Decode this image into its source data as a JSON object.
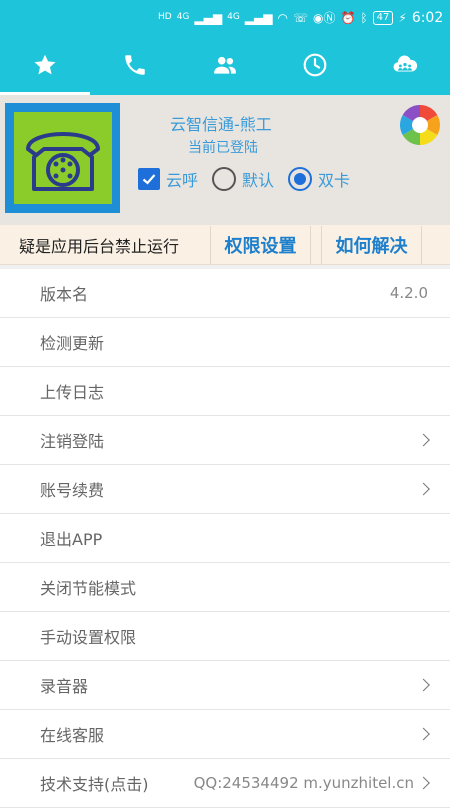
{
  "status_bar": {
    "left_indicators": [
      "HD",
      "HD",
      "4G",
      "4G"
    ],
    "battery": "47",
    "time": "6:02"
  },
  "tabs": [
    {
      "icon": "star-icon",
      "active": true
    },
    {
      "icon": "phone-icon",
      "active": false
    },
    {
      "icon": "contacts-icon",
      "active": false
    },
    {
      "icon": "clock-icon",
      "active": false
    },
    {
      "icon": "cloud-group-icon",
      "active": false
    }
  ],
  "profile": {
    "account_name": "云智信通-熊工",
    "login_status": "当前已登陆",
    "options": {
      "cloud_call": {
        "label": "云呼",
        "checked": true
      },
      "default": {
        "label": "默认",
        "selected": false
      },
      "dual_sim": {
        "label": "双卡",
        "selected": true
      }
    }
  },
  "warning": {
    "text": "疑是应用后台禁止运行",
    "permission_button": "权限设置",
    "howto_button": "如何解决"
  },
  "settings": [
    {
      "label": "版本名",
      "value": "4.2.0",
      "chevron": false
    },
    {
      "label": "检测更新",
      "value": "",
      "chevron": false
    },
    {
      "label": "上传日志",
      "value": "",
      "chevron": false
    },
    {
      "label": "注销登陆",
      "value": "",
      "chevron": true
    },
    {
      "label": "账号续费",
      "value": "",
      "chevron": true
    },
    {
      "label": "退出APP",
      "value": "",
      "chevron": false
    },
    {
      "label": "关闭节能模式",
      "value": "",
      "chevron": false
    },
    {
      "label": "手动设置权限",
      "value": "",
      "chevron": false
    },
    {
      "label": "录音器",
      "value": "",
      "chevron": true
    },
    {
      "label": "在线客服",
      "value": "",
      "chevron": true
    },
    {
      "label": "技术支持(点击)",
      "value": "QQ:24534492 m.yunzhitel.cn",
      "chevron": true
    }
  ],
  "colors": {
    "accent": "#1ec4d9",
    "link_blue": "#3a9ad9",
    "button_blue": "#1e7fcc",
    "check_blue": "#1e6fd9"
  }
}
